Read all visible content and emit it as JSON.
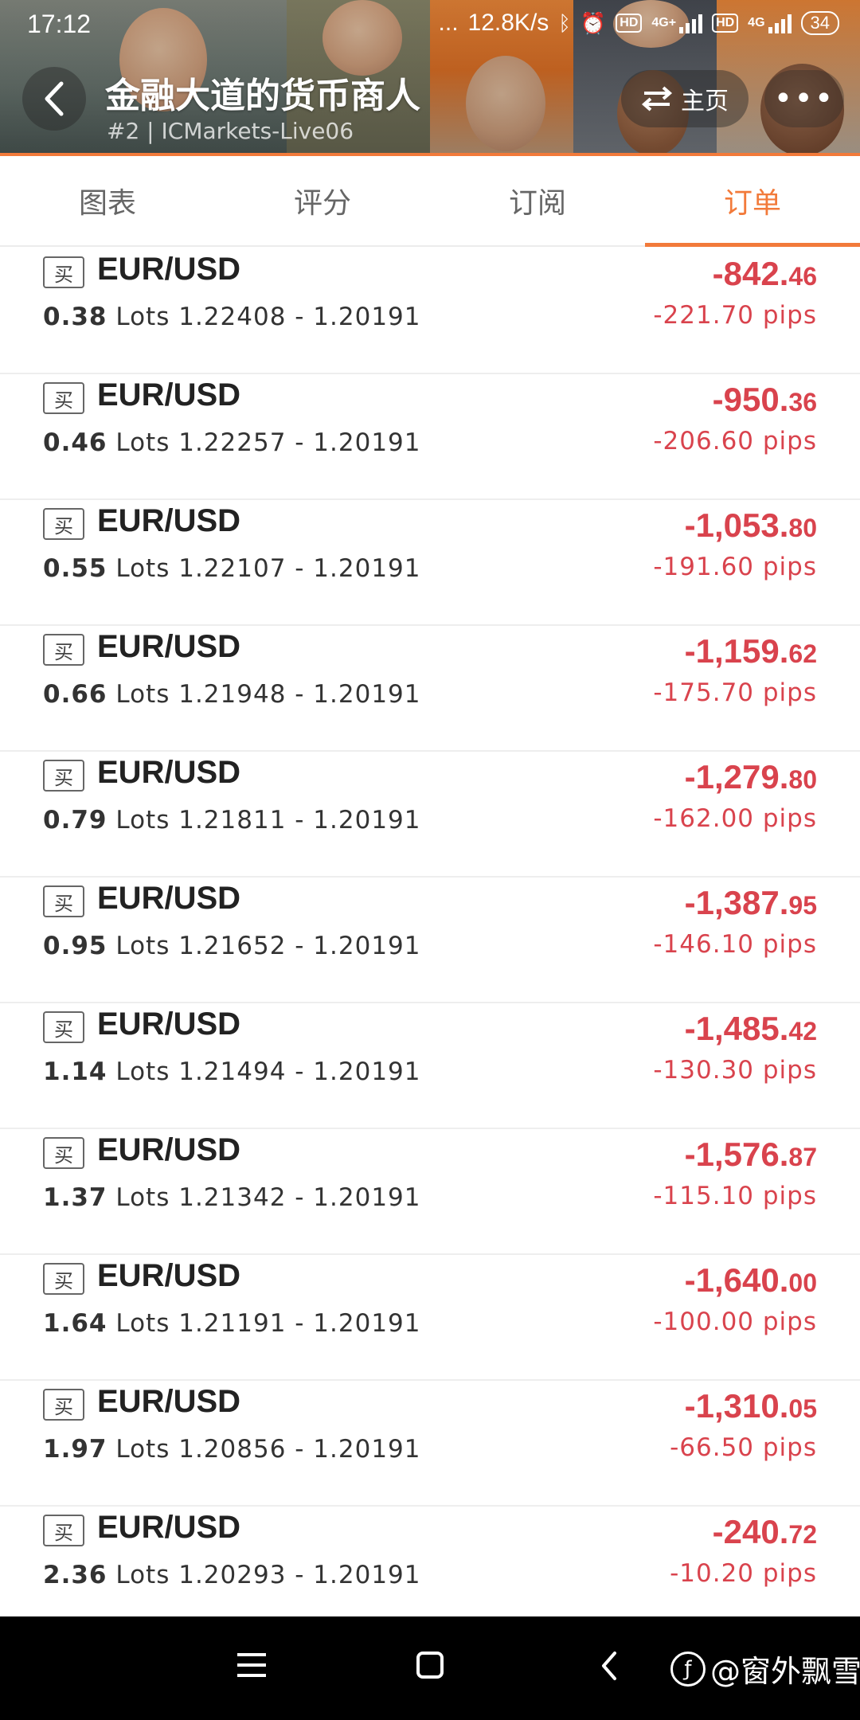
{
  "status_bar": {
    "time": "17:12",
    "dots": "...",
    "net_speed": "12.8K/s",
    "hd1": "HD",
    "net1": "4G+",
    "hd2": "HD",
    "net2": "4G",
    "battery": "34"
  },
  "header": {
    "title": "金融大道的货币商人",
    "subtitle": "#2 | ICMarkets-Live06",
    "home_label": "主页",
    "more_label": "•••"
  },
  "tabs": [
    {
      "label": "图表",
      "active": false
    },
    {
      "label": "评分",
      "active": false
    },
    {
      "label": "订阅",
      "active": false
    },
    {
      "label": "订单",
      "active": true
    }
  ],
  "orders": [
    {
      "side": "买",
      "symbol": "EUR/USD",
      "lots": "0.38",
      "lots_unit": "Lots",
      "price_range": "1.22408 - 1.20191",
      "profit_int": "-842.",
      "profit_dec": "46",
      "pips": "-221.70 pips"
    },
    {
      "side": "买",
      "symbol": "EUR/USD",
      "lots": "0.46",
      "lots_unit": "Lots",
      "price_range": "1.22257 - 1.20191",
      "profit_int": "-950.",
      "profit_dec": "36",
      "pips": "-206.60 pips"
    },
    {
      "side": "买",
      "symbol": "EUR/USD",
      "lots": "0.55",
      "lots_unit": "Lots",
      "price_range": "1.22107 - 1.20191",
      "profit_int": "-1,053.",
      "profit_dec": "80",
      "pips": "-191.60 pips"
    },
    {
      "side": "买",
      "symbol": "EUR/USD",
      "lots": "0.66",
      "lots_unit": "Lots",
      "price_range": "1.21948 - 1.20191",
      "profit_int": "-1,159.",
      "profit_dec": "62",
      "pips": "-175.70 pips"
    },
    {
      "side": "买",
      "symbol": "EUR/USD",
      "lots": "0.79",
      "lots_unit": "Lots",
      "price_range": "1.21811 - 1.20191",
      "profit_int": "-1,279.",
      "profit_dec": "80",
      "pips": "-162.00 pips"
    },
    {
      "side": "买",
      "symbol": "EUR/USD",
      "lots": "0.95",
      "lots_unit": "Lots",
      "price_range": "1.21652 - 1.20191",
      "profit_int": "-1,387.",
      "profit_dec": "95",
      "pips": "-146.10 pips"
    },
    {
      "side": "买",
      "symbol": "EUR/USD",
      "lots": "1.14",
      "lots_unit": "Lots",
      "price_range": "1.21494 - 1.20191",
      "profit_int": "-1,485.",
      "profit_dec": "42",
      "pips": "-130.30 pips"
    },
    {
      "side": "买",
      "symbol": "EUR/USD",
      "lots": "1.37",
      "lots_unit": "Lots",
      "price_range": "1.21342 - 1.20191",
      "profit_int": "-1,576.",
      "profit_dec": "87",
      "pips": "-115.10 pips"
    },
    {
      "side": "买",
      "symbol": "EUR/USD",
      "lots": "1.64",
      "lots_unit": "Lots",
      "price_range": "1.21191 - 1.20191",
      "profit_int": "-1,640.",
      "profit_dec": "00",
      "pips": "-100.00 pips"
    },
    {
      "side": "买",
      "symbol": "EUR/USD",
      "lots": "1.97",
      "lots_unit": "Lots",
      "price_range": "1.20856 - 1.20191",
      "profit_int": "-1,310.",
      "profit_dec": "05",
      "pips": "-66.50 pips"
    },
    {
      "side": "买",
      "symbol": "EUR/USD",
      "lots": "2.36",
      "lots_unit": "Lots",
      "price_range": "1.20293 - 1.20191",
      "profit_int": "-240.",
      "profit_dec": "72",
      "pips": "-10.20 pips"
    }
  ],
  "watermark": "@窗外飘雪",
  "colors": {
    "accent": "#f27a3a",
    "loss": "#d9434d"
  },
  "icons": [
    "back-icon",
    "swap-icon",
    "more-icon",
    "menu-icon",
    "home-icon",
    "nav-back-icon",
    "weibo-icon"
  ]
}
